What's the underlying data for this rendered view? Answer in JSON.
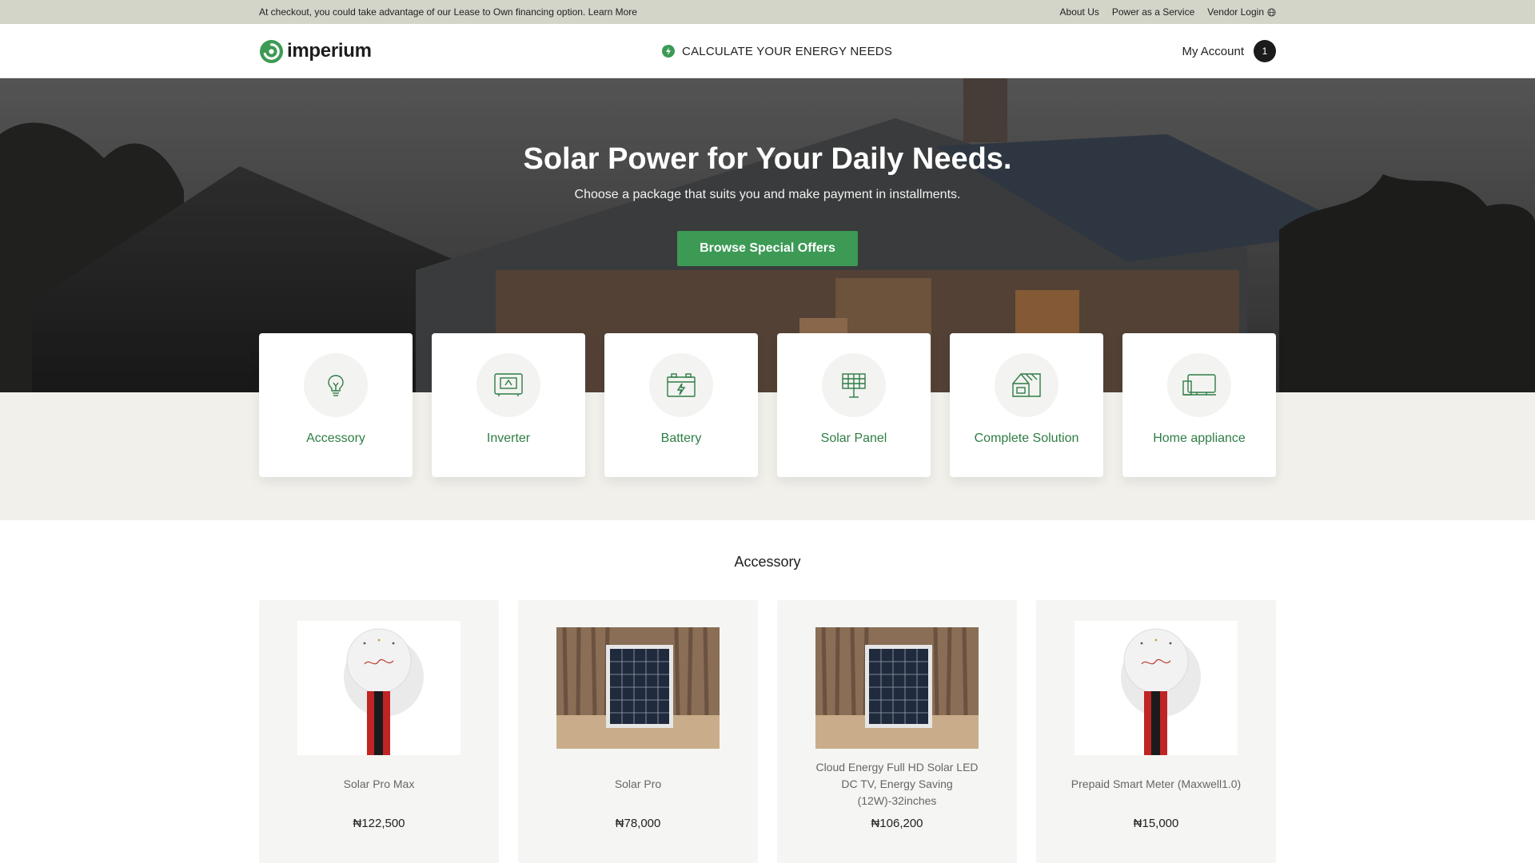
{
  "topbar": {
    "announcement": "At checkout, you could take advantage of our Lease to Own financing option. Learn More",
    "links": [
      "About Us",
      "Power as a Service",
      "Vendor Login"
    ]
  },
  "header": {
    "brand": "imperium",
    "calculator_label": "CALCULATE YOUR ENERGY NEEDS",
    "account_label": "My Account",
    "cart_count": "1"
  },
  "hero": {
    "title": "Solar Power for Your Daily Needs.",
    "subtitle": "Choose a package that suits you and make payment in installments.",
    "cta_label": "Browse Special Offers"
  },
  "categories": [
    {
      "label": "Accessory",
      "icon": "lightbulb-icon"
    },
    {
      "label": "Inverter",
      "icon": "inverter-icon"
    },
    {
      "label": "Battery",
      "icon": "battery-icon"
    },
    {
      "label": "Solar Panel",
      "icon": "solar-panel-icon"
    },
    {
      "label": "Complete Solution",
      "icon": "house-solar-icon"
    },
    {
      "label": "Home appliance",
      "icon": "tv-appliance-icon"
    }
  ],
  "section": {
    "title": "Accessory"
  },
  "products": [
    {
      "name": "Solar Pro Max",
      "price": "₦122,500"
    },
    {
      "name": "Solar Pro",
      "price": "₦78,000"
    },
    {
      "name": "Cloud Energy Full HD Solar LED DC TV, Energy Saving (12W)-32inches",
      "price": "₦106,200"
    },
    {
      "name": "Prepaid Smart Meter (Maxwell1.0)",
      "price": "₦15,000"
    }
  ],
  "colors": {
    "brand_green": "#3c9a55",
    "topbar_bg": "#d4d5c9",
    "band_bg": "#f1f0eb"
  }
}
